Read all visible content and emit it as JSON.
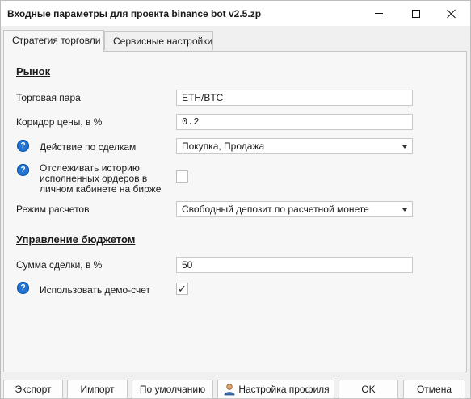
{
  "window": {
    "title": "Входные параметры для проекта binance bot v2.5.zp"
  },
  "tabs": [
    {
      "label": "Стратегия торговли"
    },
    {
      "label": "Сервисные настройки"
    }
  ],
  "market": {
    "heading": "Рынок",
    "pair_label": "Торговая пара",
    "pair_value": "ETH/BTC",
    "corridor_label": "Коридор цены, в %",
    "corridor_value": "0.2",
    "action_label": "Действие по сделкам",
    "action_value": "Покупка, Продажа",
    "history_label_1": "Отслеживать историю",
    "history_label_2": "исполненных ордеров в",
    "history_label_3": "личном кабинете на бирже",
    "history_checked": false,
    "settlement_label": "Режим расчетов",
    "settlement_value": "Свободный депозит по расчетной монете"
  },
  "budget": {
    "heading": "Управление бюджетом",
    "amount_label": "Сумма сделки, в %",
    "amount_value": "50",
    "demo_label": "Использовать демо-счет",
    "demo_checked": true,
    "demo_check_glyph": "✓"
  },
  "buttons": {
    "export": "Экспорт",
    "import": "Импорт",
    "default": "По умолчанию",
    "profile": "Настройка профиля",
    "ok": "OK",
    "cancel": "Отмена"
  },
  "icons": {
    "help": "?",
    "help_color": "#1f74d6"
  }
}
